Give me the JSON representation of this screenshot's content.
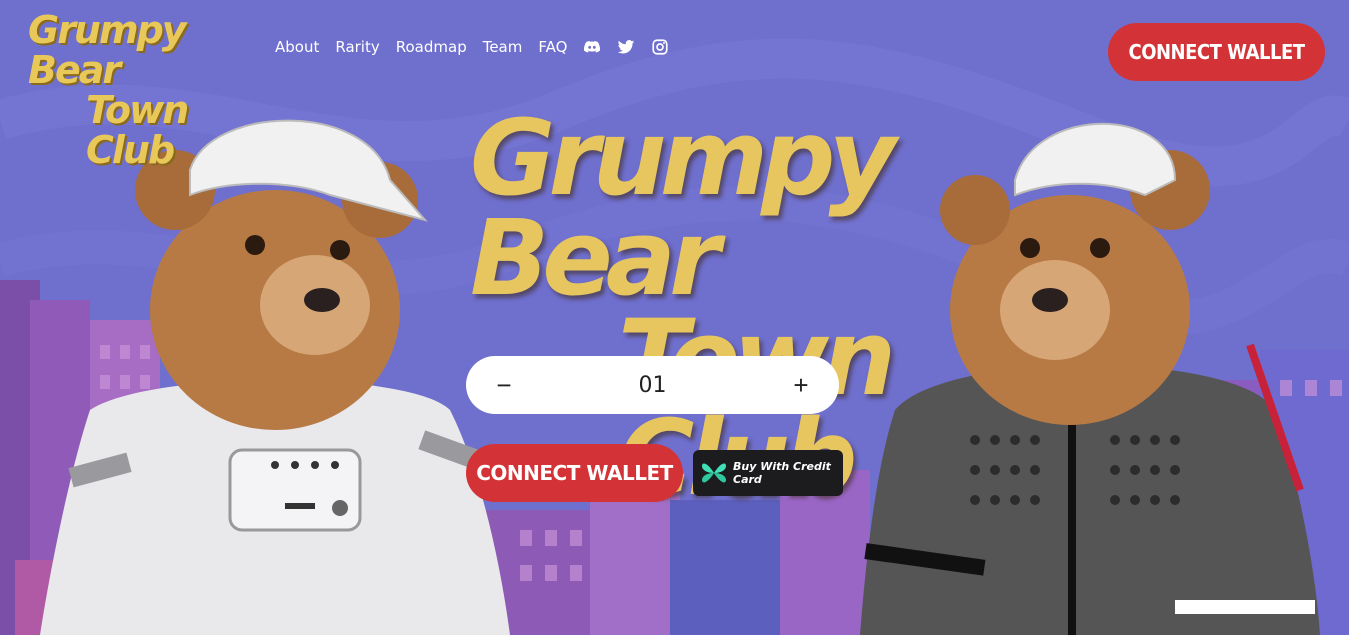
{
  "brand": {
    "line1": "Grumpy Bear",
    "line2": "Town Club"
  },
  "nav": {
    "items": [
      "About",
      "Rarity",
      "Roadmap",
      "Team",
      "FAQ"
    ],
    "social": [
      "discord-icon",
      "twitter-icon",
      "instagram-icon"
    ]
  },
  "header": {
    "connect_label": "CONNECT WALLET"
  },
  "hero": {
    "title_line1": "Grumpy Bear",
    "title_line2": "Town Club"
  },
  "mint": {
    "decrement": "−",
    "quantity": "01",
    "increment": "+",
    "connect_label": "CONNECT WALLET",
    "card_label": "Buy With Credit Card"
  },
  "colors": {
    "background": "#6f6fce",
    "accent": "#d33236",
    "gold": "#e7c65f"
  }
}
